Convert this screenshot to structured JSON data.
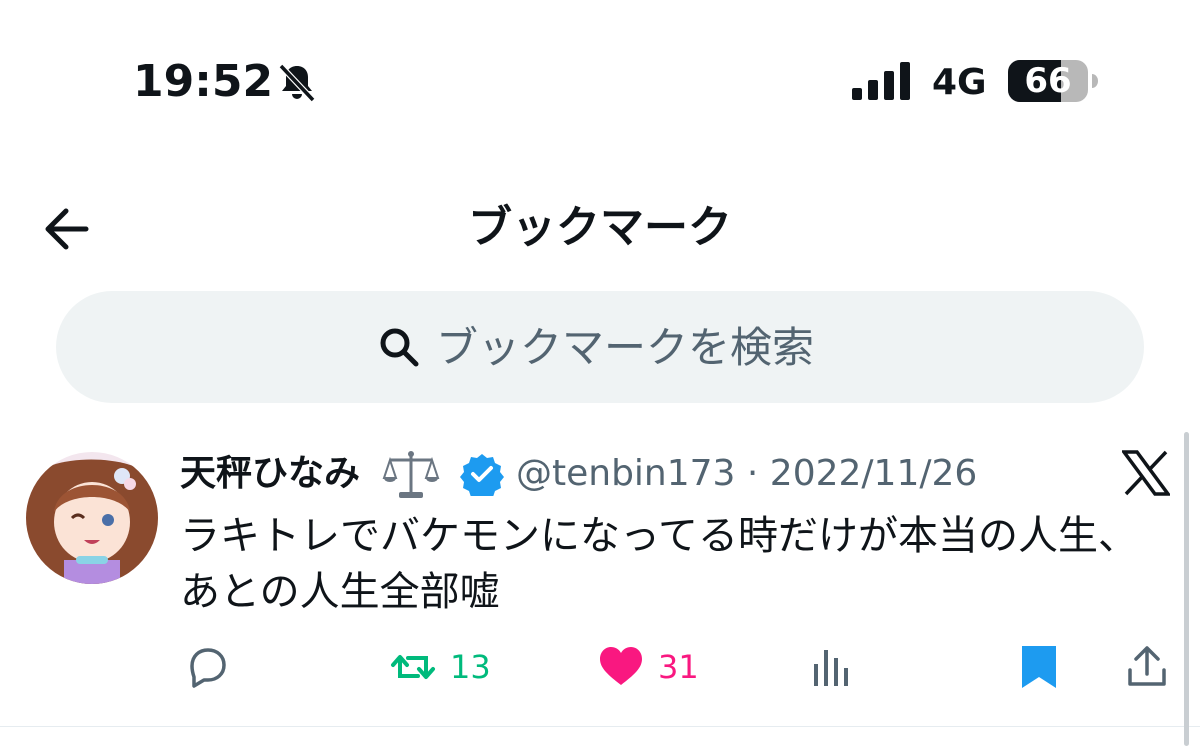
{
  "status_bar": {
    "time": "19:52",
    "network": "4G",
    "battery": "66"
  },
  "header": {
    "title": "ブックマーク"
  },
  "search": {
    "placeholder": "ブックマークを検索"
  },
  "tweet": {
    "display_name": "天秤ひなみ",
    "name_emoji": "⚖️",
    "handle_date": "@tenbin173 · 2022/11/26",
    "text": "ラキトレでバケモンになってる時だけが本当の人生、あとの人生全部嘘",
    "actions": {
      "reply_count": "",
      "retweet_count": "13",
      "like_count": "31"
    }
  },
  "colors": {
    "retweet": "#00ba7c",
    "like": "#f91880",
    "bookmark": "#1d9bf0",
    "verified": "#1d9bf0",
    "muted": "#536471"
  },
  "icons": [
    "bell-slash-icon",
    "signal-icon",
    "battery-icon",
    "back-arrow-icon",
    "search-icon",
    "verified-badge-icon",
    "x-logo-icon",
    "reply-icon",
    "retweet-icon",
    "like-icon",
    "views-icon",
    "bookmark-icon",
    "share-icon"
  ]
}
